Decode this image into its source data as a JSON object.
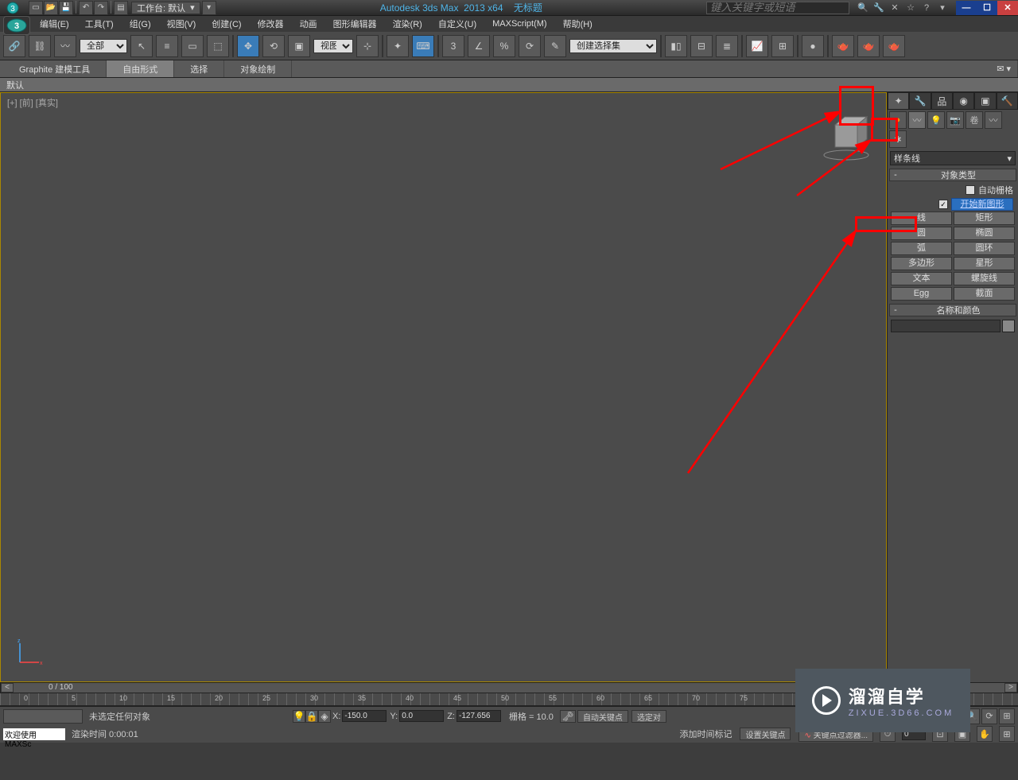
{
  "app": {
    "title_product": "Autodesk 3ds Max",
    "title_version": "2013 x64",
    "title_doc": "无标题",
    "workspace_label": "工作台: 默认",
    "search_placeholder": "键入关键字或短语"
  },
  "menu": [
    "编辑(E)",
    "工具(T)",
    "组(G)",
    "视图(V)",
    "创建(C)",
    "修改器",
    "动画",
    "图形编辑器",
    "渲染(R)",
    "自定义(U)",
    "MAXScript(M)",
    "帮助(H)"
  ],
  "toolbar": {
    "filter_all": "全部",
    "view_dd": "视图",
    "selection_set_dd": "创建选择集"
  },
  "ribbon": {
    "tabs": [
      "Graphite 建模工具",
      "自由形式",
      "选择",
      "对象绘制"
    ],
    "subtab": "默认"
  },
  "viewport": {
    "label": "[+] [前] [真实]"
  },
  "command_panel": {
    "dropdown": "样条线",
    "rollout_obj_type": "对象类型",
    "chk_autogrid": "自动栅格",
    "chk_newshape": "开始新图形",
    "buttons": [
      "线",
      "矩形",
      "圆",
      "椭圆",
      "弧",
      "圆环",
      "多边形",
      "星形",
      "文本",
      "螺旋线",
      "Egg",
      "截面"
    ],
    "rollout_name_color": "名称和颜色"
  },
  "timeline": {
    "pos": "0 / 100"
  },
  "ruler_marks": [
    0,
    5,
    10,
    15,
    20,
    25,
    30,
    35,
    40,
    45,
    50,
    55,
    60,
    65,
    70,
    75
  ],
  "status": {
    "selection": "未选定任何对象",
    "x": "-150.0",
    "y": "0.0",
    "z": "-127.656",
    "grid": "栅格 = 10.0",
    "autokey": "自动关键点",
    "setkey": "设置关键点",
    "selected": "选定对",
    "keyfilter": "关键点过滤器...",
    "addtimemark": "添加时间标记",
    "welcome": "欢迎使用 MAXSc",
    "rendertime": "渲染时间 0:00:01"
  },
  "watermark": {
    "title": "溜溜自学",
    "url": "ZIXUE.3D66.COM"
  }
}
